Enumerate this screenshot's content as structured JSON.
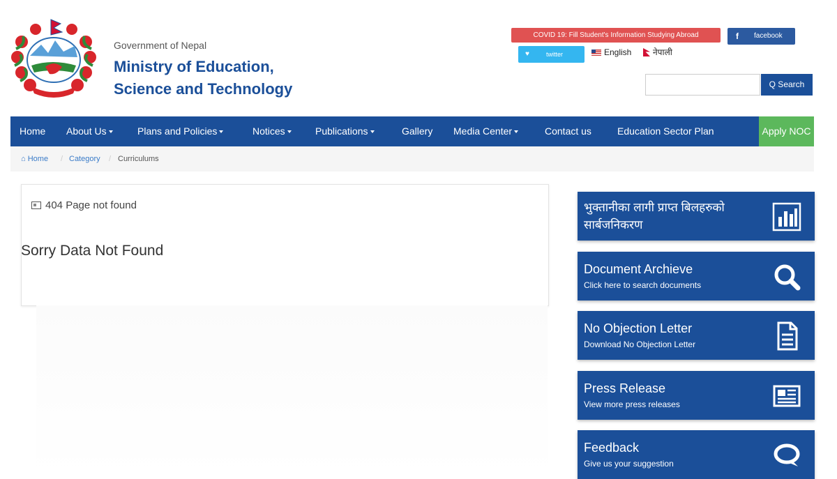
{
  "header": {
    "gov_label": "Government of Nepal",
    "ministry_line1": "Ministry of Education,",
    "ministry_line2": "Science and Technology",
    "covid_notice": "COVID 19: Fill Student's Information Studying Abroad",
    "facebook_label": "facebook",
    "facebook_icon": "f",
    "twitter_label": "twitter",
    "twitter_icon": "♥",
    "lang_en": "English",
    "lang_ne": "नेपाली",
    "search_placeholder": "",
    "search_button": "Q  Search"
  },
  "nav": {
    "items": [
      {
        "label": "Home"
      },
      {
        "label": "About Us"
      },
      {
        "label": "Plans and Policies"
      },
      {
        "label": "Notices"
      },
      {
        "label": "Publications"
      },
      {
        "label": "Gallery"
      },
      {
        "label": "Media Center"
      },
      {
        "label": "Contact us"
      },
      {
        "label": "Education Sector Plan"
      }
    ],
    "apply_noc": "Apply NOC"
  },
  "breadcrumb": {
    "home": "Home",
    "sep": "/",
    "category": "Category",
    "current": "Curriculums"
  },
  "main": {
    "not_found_label": "404 Page not found",
    "sorry_text": "Sorry Data Not Found"
  },
  "sidebar": {
    "cards": [
      {
        "title": "भुक्तानीका लागी प्राप्त बिलहरुको सार्बजनिकरण",
        "subtitle": "",
        "icon": "bar-chart-icon"
      },
      {
        "title": "Document Archieve",
        "subtitle": "Click here to search documents",
        "icon": "search-icon"
      },
      {
        "title": "No Objection Letter",
        "subtitle": "Download No Objection Letter",
        "icon": "document-icon"
      },
      {
        "title": "Press Release",
        "subtitle": "View more press releases",
        "icon": "newspaper-icon"
      },
      {
        "title": "Feedback",
        "subtitle": "Give us your suggestion",
        "icon": "chat-bubble-icon"
      }
    ]
  },
  "colors": {
    "primary": "#1b4f99",
    "covid": "#e05252",
    "twitter": "#34b6f0",
    "apply": "#5cb85c"
  }
}
